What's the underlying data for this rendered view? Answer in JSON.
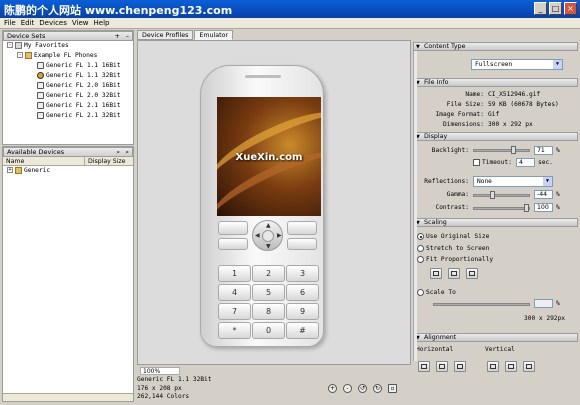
{
  "window": {
    "title": "陈鹏的个人网站  www.chenpeng123.com"
  },
  "menu": [
    "File",
    "Edit",
    "Devices",
    "View",
    "Help"
  ],
  "device_sets": {
    "header": "Device Sets",
    "favorites": "My Favorites",
    "group": "Example FL Phones",
    "items": [
      "Generic FL 1.1 16Bit",
      "Generic FL 1.1 32Bit",
      "Generic FL 2.0 16Bit",
      "Generic FL 2.0 32Bit",
      "Generic FL 2.1 16Bit",
      "Generic FL 2.1 32Bit"
    ]
  },
  "available_devices": {
    "header": "Available Devices",
    "col_name": "Name",
    "col_display": "Display Size",
    "items": [
      "Generic"
    ]
  },
  "tabs": [
    "Device Profiles",
    "Emulator"
  ],
  "emulator": {
    "zoom": "100%",
    "screen_brand": "XueXin.com",
    "keys": [
      "1",
      "2",
      "3",
      "4",
      "5",
      "6",
      "7",
      "8",
      "9",
      "*",
      "0",
      "#"
    ],
    "device_name": "Generic FL 1.1 32Bit",
    "resolution": "176 x 208 px",
    "colors": "262,144 Colors"
  },
  "content_type": {
    "header": "Content Type",
    "value": "Fullscreen"
  },
  "file_info": {
    "header": "File Info",
    "rows": [
      {
        "label": "Name:",
        "value": "CI_X512946.gif"
      },
      {
        "label": "File Size:",
        "value": "59 KB (60678 Bytes)"
      },
      {
        "label": "Image Format:",
        "value": "Gif"
      },
      {
        "label": "Dimensions:",
        "value": "300 x 292 px"
      }
    ]
  },
  "display": {
    "header": "Display",
    "backlight_label": "Backlight:",
    "backlight_value": "71",
    "backlight_level": 0.71,
    "timeout_label": "Timeout:",
    "timeout_value": "4",
    "timeout_unit": "sec.",
    "reflections_label": "Reflections:",
    "reflections_value": "None",
    "gamma_label": "Gamma:",
    "gamma_value": "-44",
    "contrast_label": "Contrast:",
    "contrast_value": "100",
    "percent": "%"
  },
  "scaling": {
    "header": "Scaling",
    "opt_original": "Use Original Size",
    "opt_stretch": "Stretch to Screen",
    "opt_fit": "Fit Proportionally",
    "opt_scale": "Scale To",
    "scale_result": "300 x 292px",
    "percent": "%"
  },
  "alignment": {
    "header": "Alignment",
    "horizontal": "Horizontal",
    "vertical": "Vertical"
  }
}
